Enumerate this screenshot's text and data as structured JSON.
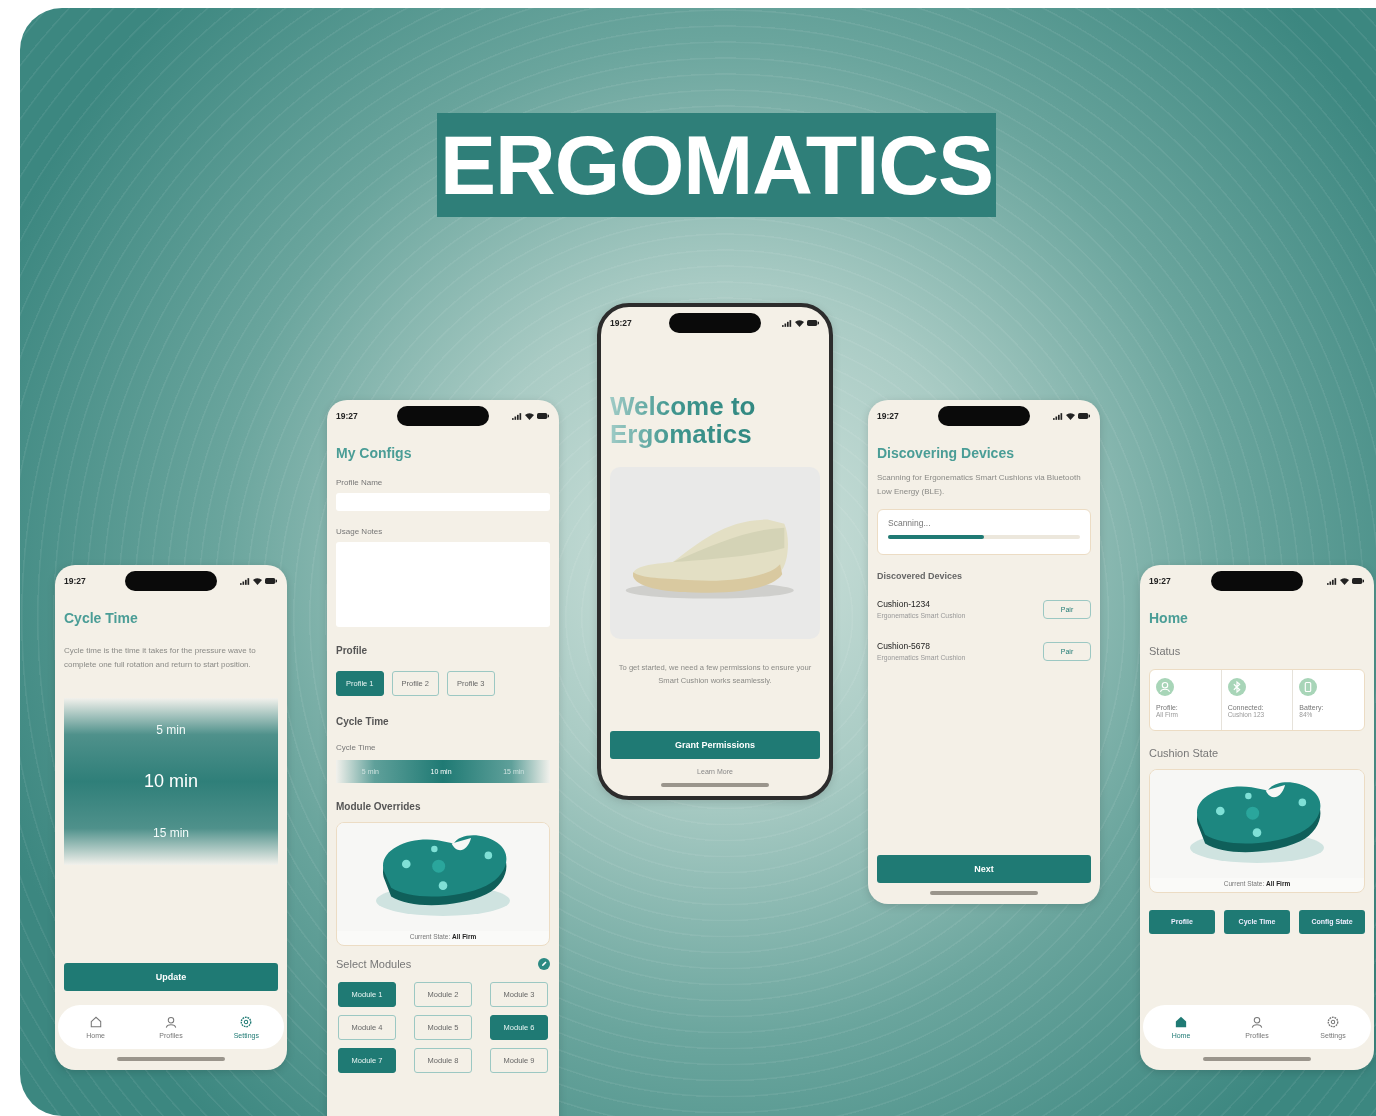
{
  "brand": "ERGOMATICS",
  "screens": [
    {
      "kind": "cycle_time",
      "time": "19:27",
      "title": "Cycle Time",
      "description": "Cycle time is the time it takes for the pressure wave to complete one full rotation and return to start position.",
      "picker": [
        {
          "label": "5 min",
          "selected": false
        },
        {
          "label": "10 min",
          "selected": true
        },
        {
          "label": "15 min",
          "selected": false
        }
      ],
      "button": "Update",
      "nav": [
        {
          "kind": "home",
          "label": "Home",
          "selected": false
        },
        {
          "kind": "profiles",
          "label": "Profiles",
          "selected": false
        },
        {
          "kind": "settings",
          "label": "Settings",
          "selected": true
        }
      ]
    },
    {
      "kind": "configs",
      "time": "19:27",
      "title": "My Configs",
      "fields": [
        {
          "kind": "line",
          "label": "Profile Name"
        },
        {
          "kind": "multiline",
          "label": "Usage Notes"
        }
      ],
      "profile_heading": "Profile",
      "profiles": [
        {
          "label": "Profile 1",
          "selected": true
        },
        {
          "label": "Profile 2",
          "selected": false
        },
        {
          "label": "Profile 3",
          "selected": false
        }
      ],
      "cycle_heading": "Cycle Time",
      "cycle_label": "Cycle Time",
      "cycle_options": [
        {
          "label": "5 min",
          "selected": false
        },
        {
          "label": "10 min",
          "selected": true
        },
        {
          "label": "15 min",
          "selected": false
        }
      ],
      "overrides_heading": "Module Overrides",
      "cushion_caption": "Current State: **All Firm**",
      "modules_heading": "Select Modules",
      "modules": [
        {
          "label": "Module 1",
          "selected": true
        },
        {
          "label": "Module 2",
          "selected": false
        },
        {
          "label": "Module 3",
          "selected": false
        },
        {
          "label": "Module 4",
          "selected": false
        },
        {
          "label": "Module 5",
          "selected": false
        },
        {
          "label": "Module 6",
          "selected": true
        },
        {
          "label": "Module 7",
          "selected": true
        },
        {
          "label": "Module 8",
          "selected": false
        },
        {
          "label": "Module 9",
          "selected": false
        }
      ]
    },
    {
      "kind": "welcome",
      "time": "19:27",
      "title": "Welcome to Ergomatics",
      "description": "To get started, we need a few permissions to ensure your Smart Cushion works seamlessly.",
      "button": "Grant Permissions",
      "link": "Learn More"
    },
    {
      "kind": "discovery",
      "time": "19:27",
      "title": "Discovering Devices",
      "description": "Scanning for Ergonematics Smart Cushions via Bluetooth Low Energy (BLE).",
      "scan": {
        "label": "Scanning...",
        "level": 0.5
      },
      "devices_heading": "Discovered Devices",
      "devices": [
        {
          "name": "Cushion-1234",
          "type": "Ergonematics Smart Cushion",
          "action": "Pair"
        },
        {
          "name": "Cushion-5678",
          "type": "Ergonematics Smart Cushion",
          "action": "Pair"
        }
      ],
      "button": "Next"
    },
    {
      "kind": "home",
      "time": "19:27",
      "title": "Home",
      "status_heading": "Status",
      "status": [
        {
          "kind": "profile",
          "label": "Profile:",
          "value": "All Firm"
        },
        {
          "kind": "connection",
          "label": "Connected:",
          "value": "Cushion 123"
        },
        {
          "kind": "battery",
          "label": "Battery:",
          "value": "84%"
        }
      ],
      "state_heading": "Cushion State",
      "cushion_caption": "Current State: **All Firm**",
      "actions": [
        "Profile",
        "Cycle Time",
        "Config State"
      ],
      "nav": [
        {
          "kind": "home",
          "label": "Home",
          "selected": true
        },
        {
          "kind": "profiles",
          "label": "Profiles",
          "selected": false
        },
        {
          "kind": "settings",
          "label": "Settings",
          "selected": false
        }
      ]
    }
  ]
}
